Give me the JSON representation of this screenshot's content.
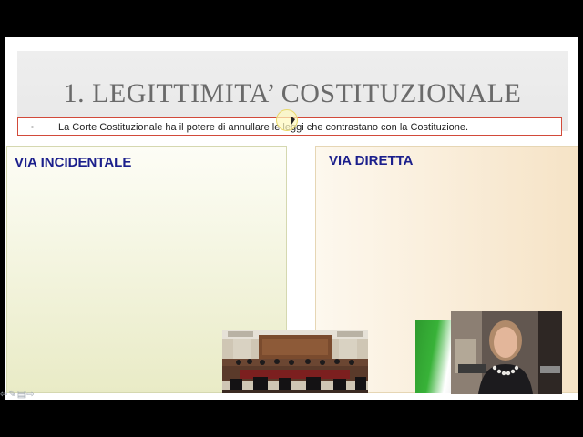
{
  "slide": {
    "title": "1. LEGITTIMITA’ COSTITUZIONALE",
    "subtitle_bullet": "▪",
    "subtitle": "La Corte Costituzionale ha il potere di annullare le leggi che contrastano con la Costituzione."
  },
  "panels": {
    "left_label": "VIA INCIDENTALE",
    "right_label": "VIA DIRETTA"
  },
  "nav_controls": {
    "glyphs": "⇦✎▤⇨"
  },
  "colors": {
    "title_text": "#6a6a6a",
    "panel_label": "#1b1f8c",
    "subtitle_border": "#d24a3a"
  }
}
